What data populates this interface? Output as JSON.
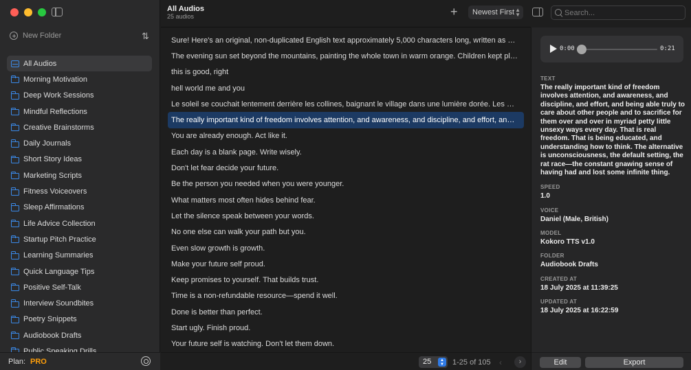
{
  "sidebar": {
    "new_folder_label": "New Folder",
    "folders": [
      {
        "label": "All Audios",
        "icon": "inbox-icon",
        "active": true
      },
      {
        "label": "Morning Motivation",
        "icon": "folder-icon"
      },
      {
        "label": "Deep Work Sessions",
        "icon": "folder-icon"
      },
      {
        "label": "Mindful Reflections",
        "icon": "folder-icon"
      },
      {
        "label": "Creative Brainstorms",
        "icon": "folder-icon"
      },
      {
        "label": "Daily Journals",
        "icon": "folder-icon"
      },
      {
        "label": "Short Story Ideas",
        "icon": "folder-icon"
      },
      {
        "label": "Marketing Scripts",
        "icon": "folder-icon"
      },
      {
        "label": "Fitness Voiceovers",
        "icon": "folder-icon"
      },
      {
        "label": "Sleep Affirmations",
        "icon": "folder-icon"
      },
      {
        "label": "Life Advice Collection",
        "icon": "folder-icon"
      },
      {
        "label": "Startup Pitch Practice",
        "icon": "folder-icon"
      },
      {
        "label": "Learning Summaries",
        "icon": "folder-icon"
      },
      {
        "label": "Quick Language Tips",
        "icon": "folder-icon"
      },
      {
        "label": "Positive Self-Talk",
        "icon": "folder-icon"
      },
      {
        "label": "Interview Soundbites",
        "icon": "folder-icon"
      },
      {
        "label": "Poetry Snippets",
        "icon": "folder-icon"
      },
      {
        "label": "Audiobook Drafts",
        "icon": "folder-icon"
      },
      {
        "label": "Public Speaking Drills",
        "icon": "folder-icon"
      }
    ],
    "plan_label": "Plan:",
    "plan_value": "PRO"
  },
  "toolbar": {
    "title": "All Audios",
    "count": "25 audios",
    "sort_value": "Newest First",
    "search_placeholder": "Search..."
  },
  "audio_list": {
    "selected_index": 6,
    "items": [
      "Sure! Here's an original, non-duplicated English text approximately 5,000 characters long, written as a reflection on time, change, and the quiet persistence of hope.",
      "The evening sun set beyond the mountains, painting the whole town in warm orange. Children kept playing in the streets long after their parents called them home.",
      "this is good, right",
      "hell world me and you",
      "Le soleil se couchait lentement derrière les collines, baignant le village dans une lumière dorée. Les enfants couraient encore dans les ruelles.",
      "The really important kind of freedom involves attention, and awareness, and discipline, and effort, and being able truly to care about other people.",
      "You are already enough. Act like it.",
      "Each day is a blank page. Write wisely.",
      "Don't let fear decide your future.",
      "Be the person you needed when you were younger.",
      "What matters most often hides behind fear.",
      "Let the silence speak between your words.",
      "No one else can walk your path but you.",
      "Even slow growth is growth.",
      "Make your future self proud.",
      "Keep promises to yourself. That builds trust.",
      "Time is a non-refundable resource—spend it well.",
      "Done is better than perfect.",
      "Start ugly. Finish proud.",
      "Your future self is watching. Don't let them down."
    ]
  },
  "pagination": {
    "page_size": "25",
    "range": "1-25 of 105"
  },
  "player": {
    "current_time": "0:00",
    "total_time": "0:21",
    "progress": 0.0
  },
  "details": {
    "text_label": "TEXT",
    "text_value": "The really important kind of freedom involves attention, and awareness, and discipline, and effort, and being able truly to care about other people and to sacrifice for them over and over in myriad petty little unsexy ways every day. That is real freedom. That is being educated, and understanding how to think. The alternative is unconsciousness, the default setting, the rat race—the constant gnawing sense of having had and lost some infinite thing.",
    "speed_label": "SPEED",
    "speed_value": "1.0",
    "voice_label": "VOICE",
    "voice_value": "Daniel (Male, British)",
    "model_label": "MODEL",
    "model_value": "Kokoro TTS v1.0",
    "folder_label": "FOLDER",
    "folder_value": "Audiobook Drafts",
    "created_label": "CREATED AT",
    "created_value": "18 July 2025 at 11:39:25",
    "updated_label": "UPDATED AT",
    "updated_value": "18 July 2025 at 16:22:59"
  },
  "actions": {
    "edit_label": "Edit",
    "export_label": "Export"
  },
  "colors": {
    "accent": "#2f7ae5",
    "selection": "#1c3a63",
    "folder_icon": "#3b8beb",
    "plan_badge": "#ff9f0a"
  }
}
